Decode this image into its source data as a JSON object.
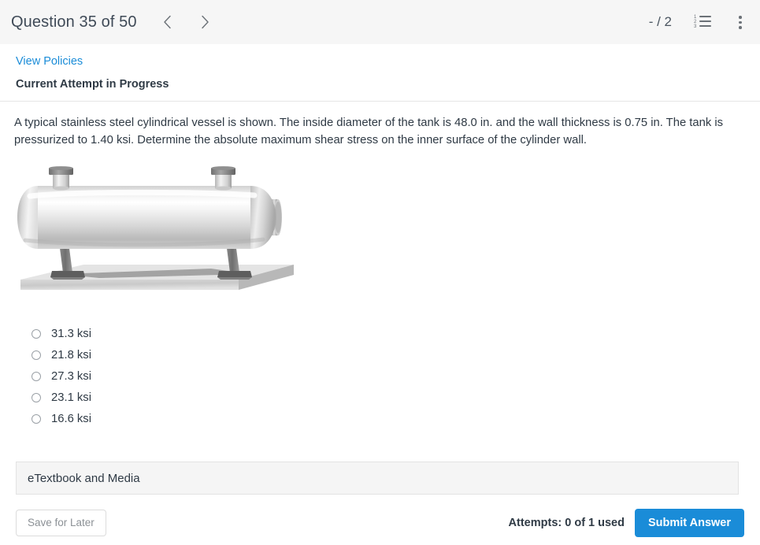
{
  "header": {
    "title": "Question 35 of 50",
    "prev_icon": "chevron-left-icon",
    "next_icon": "chevron-right-icon",
    "score": "- / 2",
    "list_icon": "numbered-list-icon",
    "list_numbers": [
      "1",
      "2",
      "3"
    ],
    "menu_icon": "kebab-menu-icon"
  },
  "status": {
    "view_policies": "View Policies",
    "attempt": "Current Attempt in Progress"
  },
  "question": {
    "text": "A typical stainless steel cylindrical vessel is shown. The inside diameter of the tank is 48.0 in. and the wall thickness is 0.75 in. The tank is pressurized to 1.40 ksi. Determine the absolute maximum shear stress on the inner surface of the cylinder wall.",
    "figure_name": "horizontal-cylindrical-pressure-vessel-diagram"
  },
  "options": [
    {
      "label": "31.3 ksi",
      "selected": false
    },
    {
      "label": "21.8 ksi",
      "selected": false
    },
    {
      "label": "27.3 ksi",
      "selected": false
    },
    {
      "label": "23.1 ksi",
      "selected": false
    },
    {
      "label": "16.6 ksi",
      "selected": false
    }
  ],
  "etextbook": {
    "label": "eTextbook and Media"
  },
  "footer": {
    "save_label": "Save for Later",
    "attempts": "Attempts: 0 of 1 used",
    "submit_label": "Submit Answer"
  },
  "colors": {
    "accent": "#1a8cd8",
    "header_bg": "#f6f6f6",
    "text": "#2f3a45",
    "panel_bg": "#f5f5f5"
  }
}
